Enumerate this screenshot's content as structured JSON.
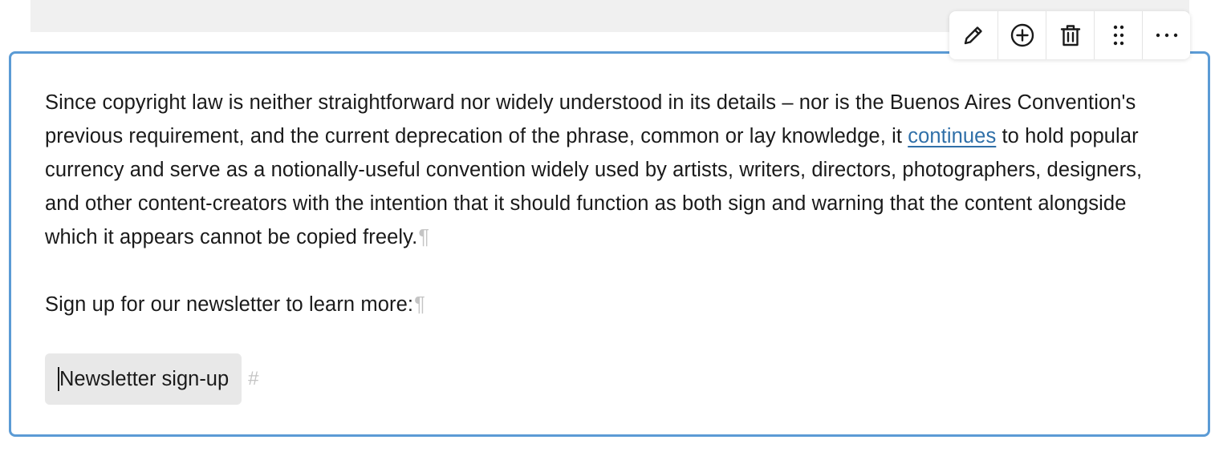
{
  "editor": {
    "paragraph1": {
      "text_before_link": "Since copyright law is neither straightforward nor widely understood in its details – nor is the Buenos Aires Convention's previous requirement, and the current deprecation of the phrase, common or lay knowledge, it ",
      "link_text": "continues",
      "text_after_link": " to hold popular currency and serve as a notionally-useful convention widely used by artists, writers, directors, photographers, designers, and other content-creators with the intention that it should function as both sign and warning that the content alongside which it appears cannot be copied freely.",
      "pilcrow": "¶"
    },
    "paragraph2": {
      "text": "Sign up for our newsletter to learn more:",
      "pilcrow": "¶"
    },
    "newsletter_anchor": {
      "label": "Newsletter sign-up",
      "marker": "#"
    }
  },
  "toolbar": {
    "buttons": [
      {
        "name": "edit",
        "icon": "pencil-icon"
      },
      {
        "name": "add",
        "icon": "plus-circle-icon"
      },
      {
        "name": "delete",
        "icon": "trash-icon"
      },
      {
        "name": "drag",
        "icon": "drag-handle-icon"
      },
      {
        "name": "more",
        "icon": "ellipsis-icon"
      }
    ]
  },
  "colors": {
    "selection_border": "#5b9bd5",
    "link": "#2f6fa8",
    "invisible_chars": "#c4c4c4",
    "anchor_background": "#e8e8e8"
  }
}
